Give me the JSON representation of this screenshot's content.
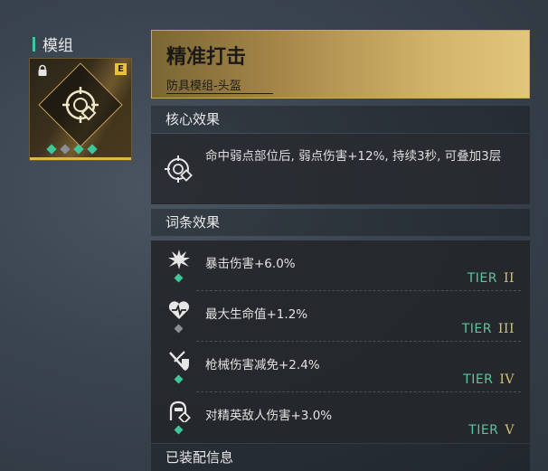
{
  "section": {
    "label": "模组"
  },
  "module_card": {
    "grade": "E",
    "slots": [
      "on",
      "off",
      "on",
      "on"
    ],
    "icon": "crosshair-target-icon",
    "lock_icon": "lock-icon"
  },
  "detail": {
    "name": "精准打击",
    "subtitle": "防具模组-头盔",
    "core_header": "核心效果",
    "core_text": "命中弱点部位后, 弱点伤害+12%, 持续3秒, 可叠加3层",
    "affix_header": "词条效果",
    "affixes": [
      {
        "icon": "explosion-icon",
        "label": "暴击伤害+6.0%",
        "tier_word": "TIER",
        "tier_num": "II",
        "gem": "on"
      },
      {
        "icon": "heart-pulse-icon",
        "label": "最大生命值+1.2%",
        "tier_word": "TIER",
        "tier_num": "III",
        "gem": "off"
      },
      {
        "icon": "gun-shield-icon",
        "label": "枪械伤害减免+2.4%",
        "tier_word": "TIER",
        "tier_num": "IV",
        "gem": "on"
      },
      {
        "icon": "elite-enemy-icon",
        "label": "对精英敌人伤害+3.0%",
        "tier_word": "TIER",
        "tier_num": "V",
        "gem": "on"
      }
    ],
    "equip_header": "已装配信息"
  },
  "colors": {
    "accent_green": "#3ec79a",
    "gold": "#e0b64a",
    "tier_numeral": "#d8c27c"
  }
}
